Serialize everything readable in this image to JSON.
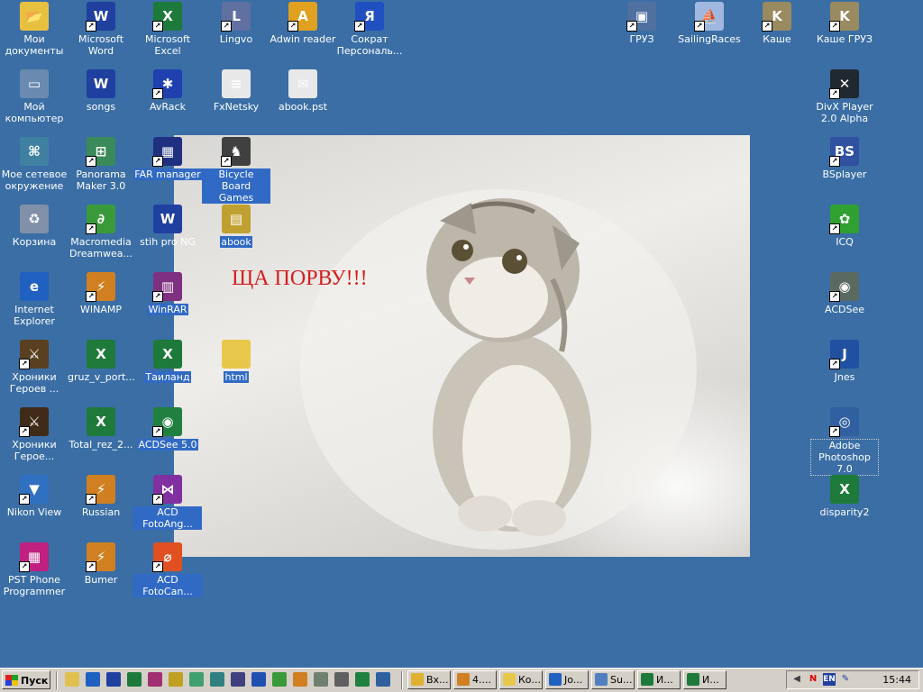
{
  "wallpaper": {
    "caption": "ЩА ПОРВУ!!!"
  },
  "desktop_icons": [
    {
      "label": "Мои документы",
      "icon": "folder-documents-icon",
      "color": "#e8c040",
      "glyph": "📂"
    },
    {
      "label": "Microsoft Word",
      "icon": "word-icon",
      "color": "#2040a0",
      "glyph": "W"
    },
    {
      "label": "Microsoft Excel",
      "icon": "excel-icon",
      "color": "#1e7a3a",
      "glyph": "X"
    },
    {
      "label": "Lingvo",
      "icon": "lingvo-icon",
      "color": "#6070a0",
      "glyph": "L"
    },
    {
      "label": "Adwin reader",
      "icon": "adwin-reader-icon",
      "color": "#e0a020",
      "glyph": "A"
    },
    {
      "label": "Сократ Персональ...",
      "icon": "sokrat-icon",
      "color": "#2050c0",
      "glyph": "Я"
    },
    {
      "label": "ГРУЗ",
      "icon": "computer-shortcut-icon",
      "color": "#5070a0",
      "glyph": "▣"
    },
    {
      "label": "SailingRaces",
      "icon": "sailing-races-icon",
      "color": "#a0b8e0",
      "glyph": "⛵"
    },
    {
      "label": "Каше",
      "icon": "kashe-icon",
      "color": "#9a8a60",
      "glyph": "K"
    },
    {
      "label": "Каше ГРУЗ",
      "icon": "kashe-gruz-icon",
      "color": "#9a8a60",
      "glyph": "K"
    },
    {
      "label": "Мой компьютер",
      "icon": "my-computer-icon",
      "color": "#6a8ab0",
      "glyph": "▭"
    },
    {
      "label": "songs",
      "icon": "word-doc-icon",
      "color": "#2040a0",
      "glyph": "W"
    },
    {
      "label": "AvRack",
      "icon": "avrack-icon",
      "color": "#2040b0",
      "glyph": "✱"
    },
    {
      "label": "FxNetsky",
      "icon": "text-file-icon",
      "color": "#e8e8e8",
      "glyph": "≡"
    },
    {
      "label": "abook.pst",
      "icon": "pst-file-icon",
      "color": "#e8e8e8",
      "glyph": "✉"
    },
    {
      "label": "DivX Player 2.0 Alpha",
      "icon": "divx-player-icon",
      "color": "#202830",
      "glyph": "✕"
    },
    {
      "label": "Мое сетевое окружение",
      "icon": "network-places-icon",
      "color": "#4080a0",
      "glyph": "⌘"
    },
    {
      "label": "Panorama Maker 3.0",
      "icon": "panorama-maker-icon",
      "color": "#3a8a5a",
      "glyph": "⊞"
    },
    {
      "label": "FAR manager",
      "icon": "far-manager-icon",
      "color": "#203080",
      "glyph": "▦"
    },
    {
      "label": "Bicycle Board Games",
      "icon": "chess-knight-icon",
      "color": "#404040",
      "glyph": "♞"
    },
    {
      "label": "BSplayer",
      "icon": "bsplayer-icon",
      "color": "#3050a0",
      "glyph": "BS"
    },
    {
      "label": "Корзина",
      "icon": "recycle-bin-icon",
      "color": "#8090a8",
      "glyph": "♻"
    },
    {
      "label": "Macromedia Dreamwea...",
      "icon": "dreamweaver-icon",
      "color": "#3a9a3a",
      "glyph": "∂"
    },
    {
      "label": "stih pro NG",
      "icon": "word-doc-icon",
      "color": "#2040a0",
      "glyph": "W"
    },
    {
      "label": "abook",
      "icon": "archive-icon",
      "color": "#c0a030",
      "glyph": "▤"
    },
    {
      "label": "ICQ",
      "icon": "icq-flower-icon",
      "color": "#30a030",
      "glyph": "✿"
    },
    {
      "label": "Internet Explorer",
      "icon": "internet-explorer-icon",
      "color": "#2060c0",
      "glyph": "e"
    },
    {
      "label": "WINAMP",
      "icon": "winamp-icon",
      "color": "#d08020",
      "glyph": "⚡"
    },
    {
      "label": "WinRAR",
      "icon": "winrar-icon",
      "color": "#803080",
      "glyph": "▥"
    },
    {
      "label": "ACDSee",
      "icon": "acdsee-eye-icon",
      "color": "#5a6a60",
      "glyph": "◉"
    },
    {
      "label": "Хроники Героев ...",
      "icon": "game-hero-icon",
      "color": "#5a4020",
      "glyph": "⚔"
    },
    {
      "label": "gruz_v_port...",
      "icon": "excel-doc-icon",
      "color": "#1e7a3a",
      "glyph": "X"
    },
    {
      "label": "Таиланд",
      "icon": "excel-doc-icon",
      "color": "#1e7a3a",
      "glyph": "X"
    },
    {
      "label": "html",
      "icon": "folder-icon",
      "color": "#e8c84a",
      "glyph": ""
    },
    {
      "label": "Jnes",
      "icon": "jnes-icon",
      "color": "#2050a0",
      "glyph": "J"
    },
    {
      "label": "Хроники Герое...",
      "icon": "game-hero-icon",
      "color": "#402a18",
      "glyph": "⚔"
    },
    {
      "label": "Total_rez_2...",
      "icon": "excel-doc-icon",
      "color": "#1e7a3a",
      "glyph": "X"
    },
    {
      "label": "ACDSee 5.0",
      "icon": "acdsee-icon",
      "color": "#208040",
      "glyph": "◉"
    },
    {
      "label": "Adobe Photoshop 7.0",
      "icon": "photoshop-icon",
      "color": "#3060a0",
      "glyph": "◎"
    },
    {
      "label": "Nikon View",
      "icon": "nikon-view-icon",
      "color": "#3070c0",
      "glyph": "▼"
    },
    {
      "label": "Russian",
      "icon": "winamp-icon",
      "color": "#d08020",
      "glyph": "⚡"
    },
    {
      "label": "ACD FotoAng...",
      "icon": "acd-fotoangelo-icon",
      "color": "#8030a0",
      "glyph": "⋈"
    },
    {
      "label": "disparity2",
      "icon": "excel-doc-icon",
      "color": "#1e7a3a",
      "glyph": "X"
    },
    {
      "label": "PST Phone Programmer",
      "icon": "pst-phone-icon",
      "color": "#c02080",
      "glyph": "▦"
    },
    {
      "label": "Bumer",
      "icon": "winamp-icon",
      "color": "#d08020",
      "glyph": "⚡"
    },
    {
      "label": "ACD FotoCan...",
      "icon": "acd-fotocanvas-icon",
      "color": "#e05020",
      "glyph": "⌀"
    }
  ],
  "taskbar": {
    "start_label": "Пуск",
    "tasks": [
      {
        "label": "Вх...",
        "icon": "outlook-icon",
        "color": "#e0b030"
      },
      {
        "label": "4....",
        "icon": "winamp-icon",
        "color": "#d08020"
      },
      {
        "label": "Ко...",
        "icon": "folder-icon",
        "color": "#e8c84a"
      },
      {
        "label": "Jo...",
        "icon": "ie-icon",
        "color": "#2060c0"
      },
      {
        "label": "Su...",
        "icon": "app-icon",
        "color": "#5080c0"
      },
      {
        "label": "И...",
        "icon": "excel-icon",
        "color": "#1e7a3a"
      },
      {
        "label": "И...",
        "icon": "excel-icon",
        "color": "#1e7a3a"
      }
    ],
    "tray": {
      "language": "EN",
      "clock": "15:44"
    }
  }
}
